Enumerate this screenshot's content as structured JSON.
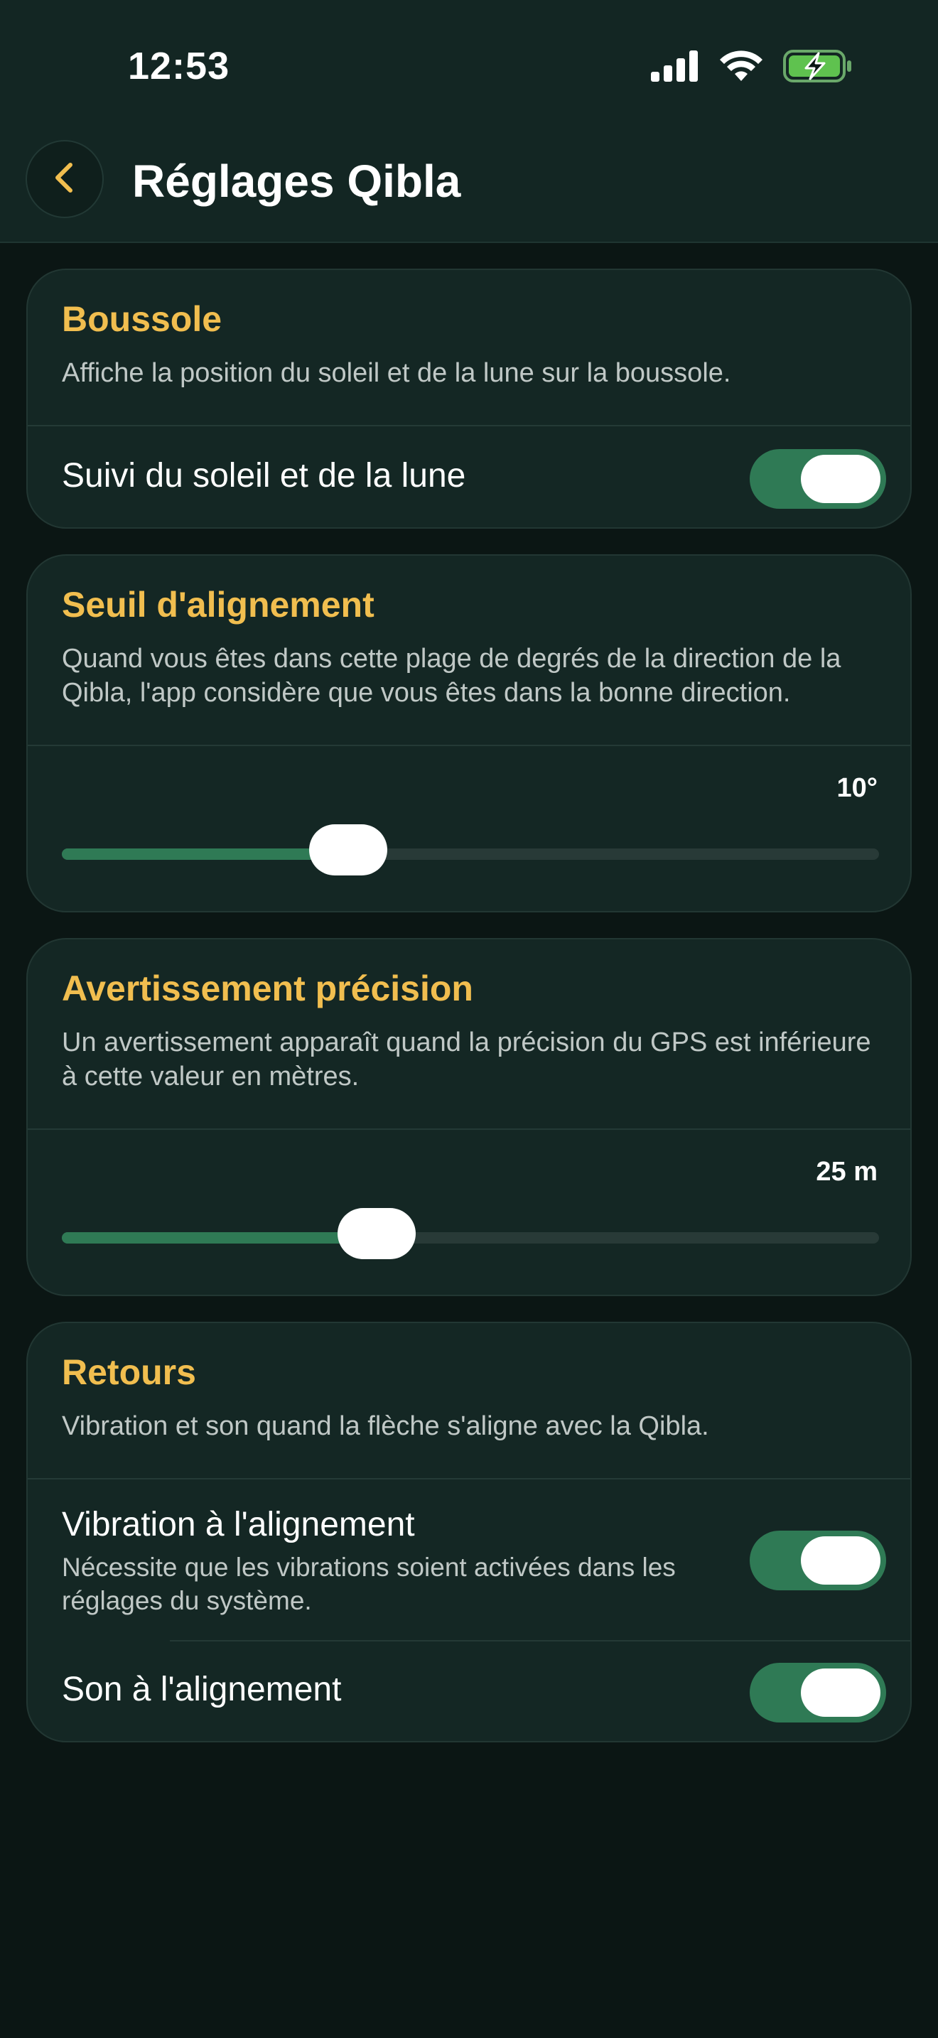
{
  "status_bar": {
    "time": "12:53",
    "icons": [
      "cellular-signal-icon",
      "wifi-icon",
      "battery-charging-icon"
    ]
  },
  "header": {
    "back_icon": "chevron-left-icon",
    "title": "Réglages Qibla"
  },
  "colors": {
    "accent": "#f1be4f",
    "toggle_on": "#2f7a55",
    "card_bg": "#142724",
    "page_bg": "#0b1614"
  },
  "sections": {
    "compass": {
      "title": "Boussole",
      "description": "Affiche la position du soleil et de la lune sur la boussole.",
      "toggle_label": "Suivi du soleil et de la lune",
      "toggle_on": true
    },
    "alignment": {
      "title": "Seuil d'alignement",
      "description": "Quand vous êtes dans cette plage de degrés de la direction de la Qibla, l'app considère que vous êtes dans la bonne direction.",
      "value_label": "10°",
      "slider_fraction": 0.35
    },
    "accuracy": {
      "title": "Avertissement précision",
      "description": "Un avertissement apparaît quand la précision du GPS est inférieure à cette valeur en mètres.",
      "value_label": "25 m",
      "slider_fraction": 0.385
    },
    "feedback": {
      "title": "Retours",
      "description": "Vibration et son quand la flèche s'aligne avec la Qibla.",
      "vibration_label": "Vibration à l'alignement",
      "vibration_sub": "Nécessite que les vibrations soient activées dans les réglages du système.",
      "vibration_on": true,
      "sound_label": "Son à l'alignement",
      "sound_on": true
    }
  }
}
